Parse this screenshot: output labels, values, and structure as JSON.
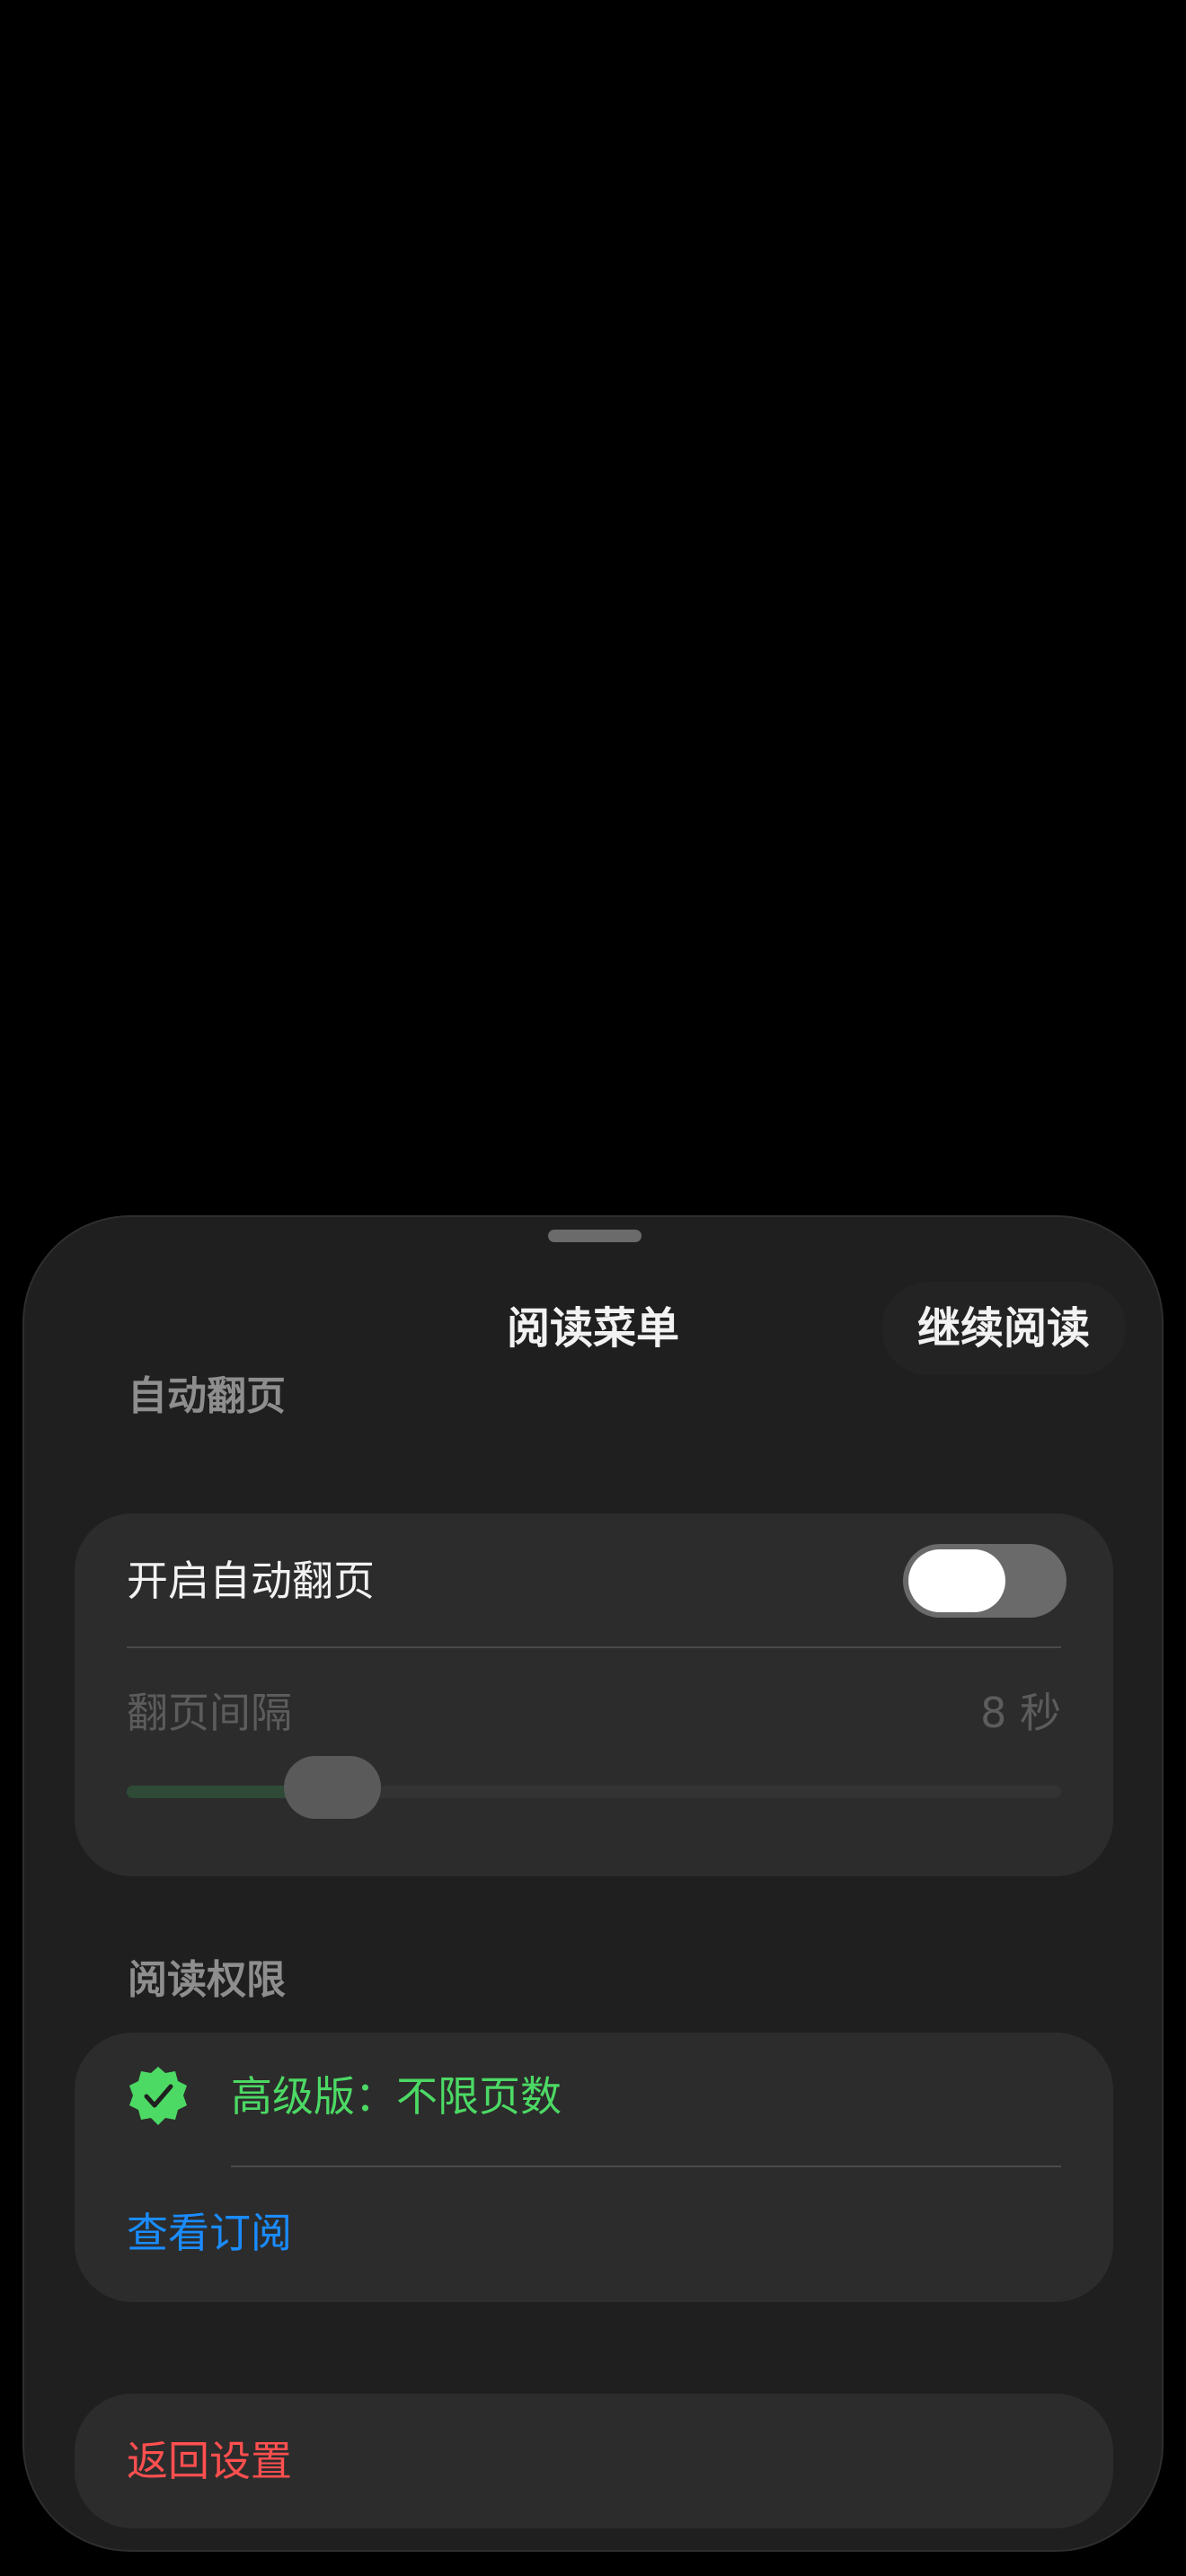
{
  "sheet": {
    "title": "阅读菜单",
    "continue_label": "继续阅读"
  },
  "auto_page": {
    "section_title": "自动翻页",
    "toggle_label": "开启自动翻页",
    "toggle_on": true,
    "interval_label": "翻页间隔",
    "interval_value": "8 秒",
    "interval_fraction": 0.22
  },
  "permission": {
    "section_title": "阅读权限",
    "badge_icon": "verified-badge-icon",
    "status_text": "高级版：不限页数",
    "subscription_link": "查看订阅"
  },
  "footer": {
    "back_label": "返回设置"
  },
  "colors": {
    "accent_green": "#4cd964",
    "link_blue": "#1a8cff",
    "destructive_red": "#ff4f4f"
  }
}
